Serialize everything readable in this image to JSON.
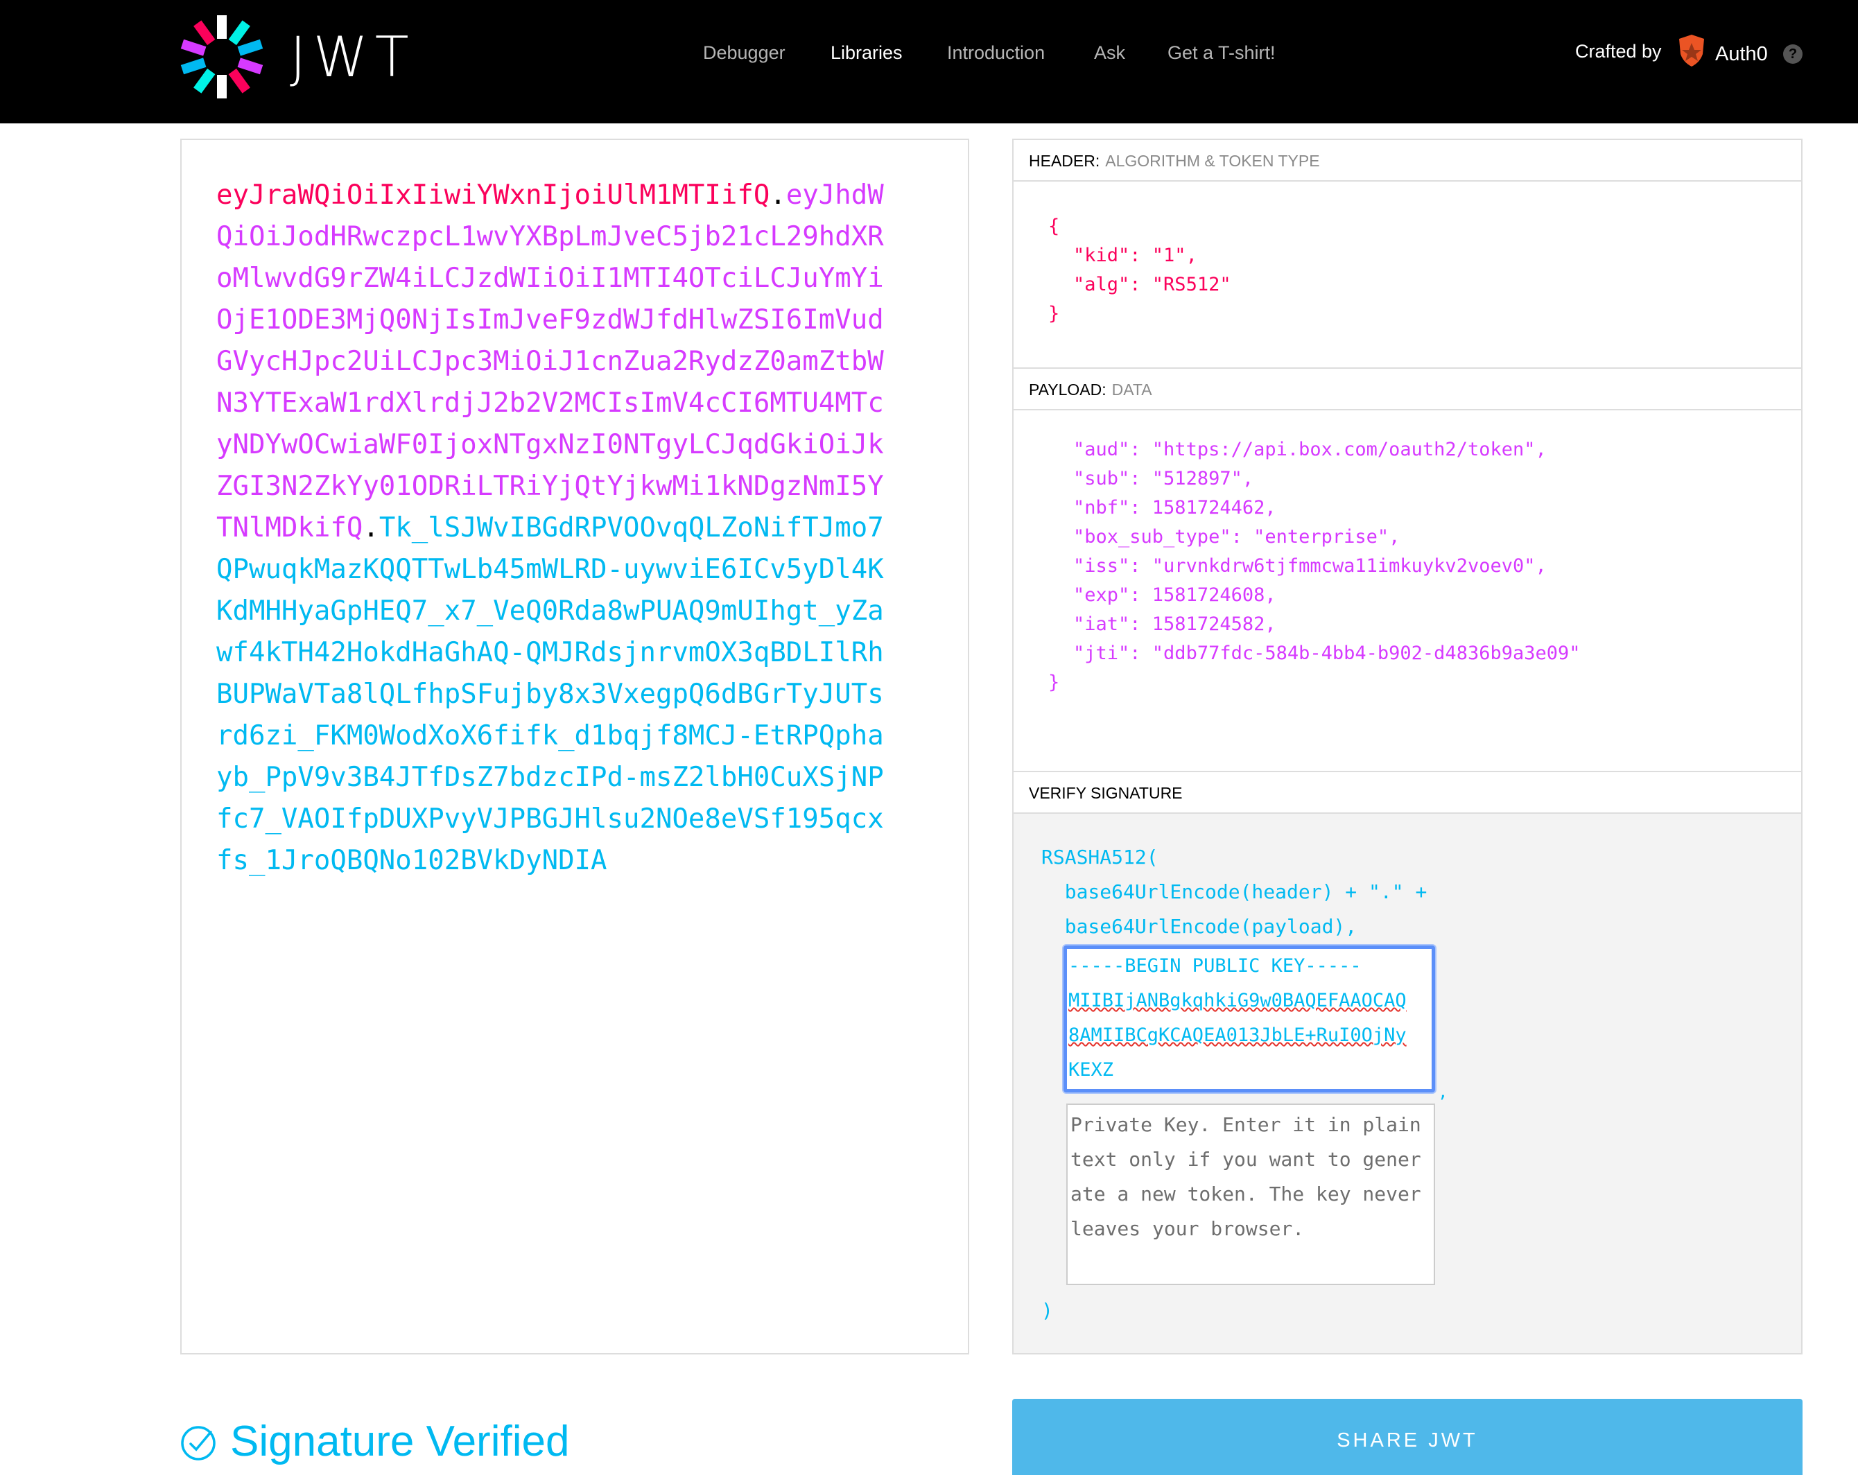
{
  "brand": {
    "name": "JWT"
  },
  "nav": {
    "items": [
      "Debugger",
      "Libraries",
      "Introduction",
      "Ask",
      "Get a T-shirt!"
    ],
    "active": "Libraries",
    "crafted_by": "Crafted by",
    "auth0": "Auth0",
    "help": "?"
  },
  "encoded": {
    "header": "eyJraWQiOiIxIiwiYWxnIjoiUlM1MTIifQ",
    "dot1": ".",
    "payload": "eyJhdWQiOiJodHRwczpcL1wvYXBpLmJveC5jb21cL29hdXRoMlwvdG9rZW4iLCJzdWIiOiI1MTI4OTciLCJuYmYiOjE1ODE3MjQ0NjIsImJveF9zdWJfdHlwZSI6ImVudGVycHJpc2UiLCJpc3MiOiJ1cnZua2RydzZ0amZtbWN3YTExaW1rdXlrdjJ2b2V2MCIsImV4cCI6MTU4MTcyNDYwOCwiaWF0IjoxNTgxNzI0NTgyLCJqdGkiOiJkZGI3N2ZkYy01ODRiLTRiYjQtYjkwMi1kNDgzNmI5YTNlMDkifQ",
    "dot2": ".",
    "signature": "Tk_lSJWvIBGdRPVOOvqQLZoNifTJmo7QPwuqkMazKQQTTwLb45mWLRD-uywviE6ICv5yDl4KKdMHHyaGpHEQ7_x7_VeQ0Rda8wPUAQ9mUIhgt_yZawf4kTH42HokdHaGhAQ-QMJRdsjnrvmOX3qBDLIlRhBUPWaVTa8lQLfhpSFujby8x3VxegpQ6dBGrTyJUTsrd6zi_FKM0WodXoX6fifk_d1bqjf8MCJ-EtRPQphayb_PpV9v3B4JTfDsZ7bdzcIPd-msZ2lbH0CuXSjNPfc7_VAOIfpDUXPvyVJPBGJHlsu2NOe8eVSf195qcxfs_1JroQBQNo102BVkDyNDIA"
  },
  "header_section": {
    "title": "HEADER:",
    "subtitle": "ALGORITHM & TOKEN TYPE",
    "open": "{",
    "line1_key": "\"kid\"",
    "line1_val": "\"1\",",
    "line2_key": "\"alg\"",
    "line2_val": "\"RS512\"",
    "close": "}"
  },
  "payload_section": {
    "title": "PAYLOAD:",
    "subtitle": "DATA",
    "fields": [
      {
        "key": "\"aud\"",
        "value": "\"https://api.box.com/oauth2/token\","
      },
      {
        "key": "\"sub\"",
        "value": "\"512897\","
      },
      {
        "key": "\"nbf\"",
        "value": "1581724462,"
      },
      {
        "key": "\"box_sub_type\"",
        "value": "\"enterprise\","
      },
      {
        "key": "\"iss\"",
        "value": "\"urvnkdrw6tjfmmcwa11imkuykv2voev0\","
      },
      {
        "key": "\"exp\"",
        "value": "1581724608,"
      },
      {
        "key": "\"iat\"",
        "value": "1581724582,"
      },
      {
        "key": "\"jti\"",
        "value": "\"ddb77fdc-584b-4bb4-b902-d4836b9a3e09\""
      }
    ],
    "close": "}"
  },
  "verify_section": {
    "title": "VERIFY SIGNATURE",
    "line1": "RSASHA512(",
    "line2": "  base64UrlEncode(header) + \".\" +",
    "line3": "  base64UrlEncode(payload),",
    "public_key": {
      "line1": "-----BEGIN PUBLIC KEY-----",
      "line2": "MIIBIjANBgkqhkiG9w0BAQEFAAOCAQ",
      "line3": "8AMIIBCgKCAQEA013JbLE+RuI0OjNy",
      "line4": "KEXZ"
    },
    "comma": ",",
    "private_key_placeholder": "Private Key. Enter it in plain text only if you want to generate a new token. The key never leaves your browser.",
    "close": ")"
  },
  "status": {
    "verified": "Signature Verified"
  },
  "share": {
    "label": "SHARE JWT"
  },
  "colors": {
    "header": "#fb015b",
    "payload": "#d63aff",
    "signature": "#00b9f1",
    "share_button": "#4fb8ea"
  }
}
